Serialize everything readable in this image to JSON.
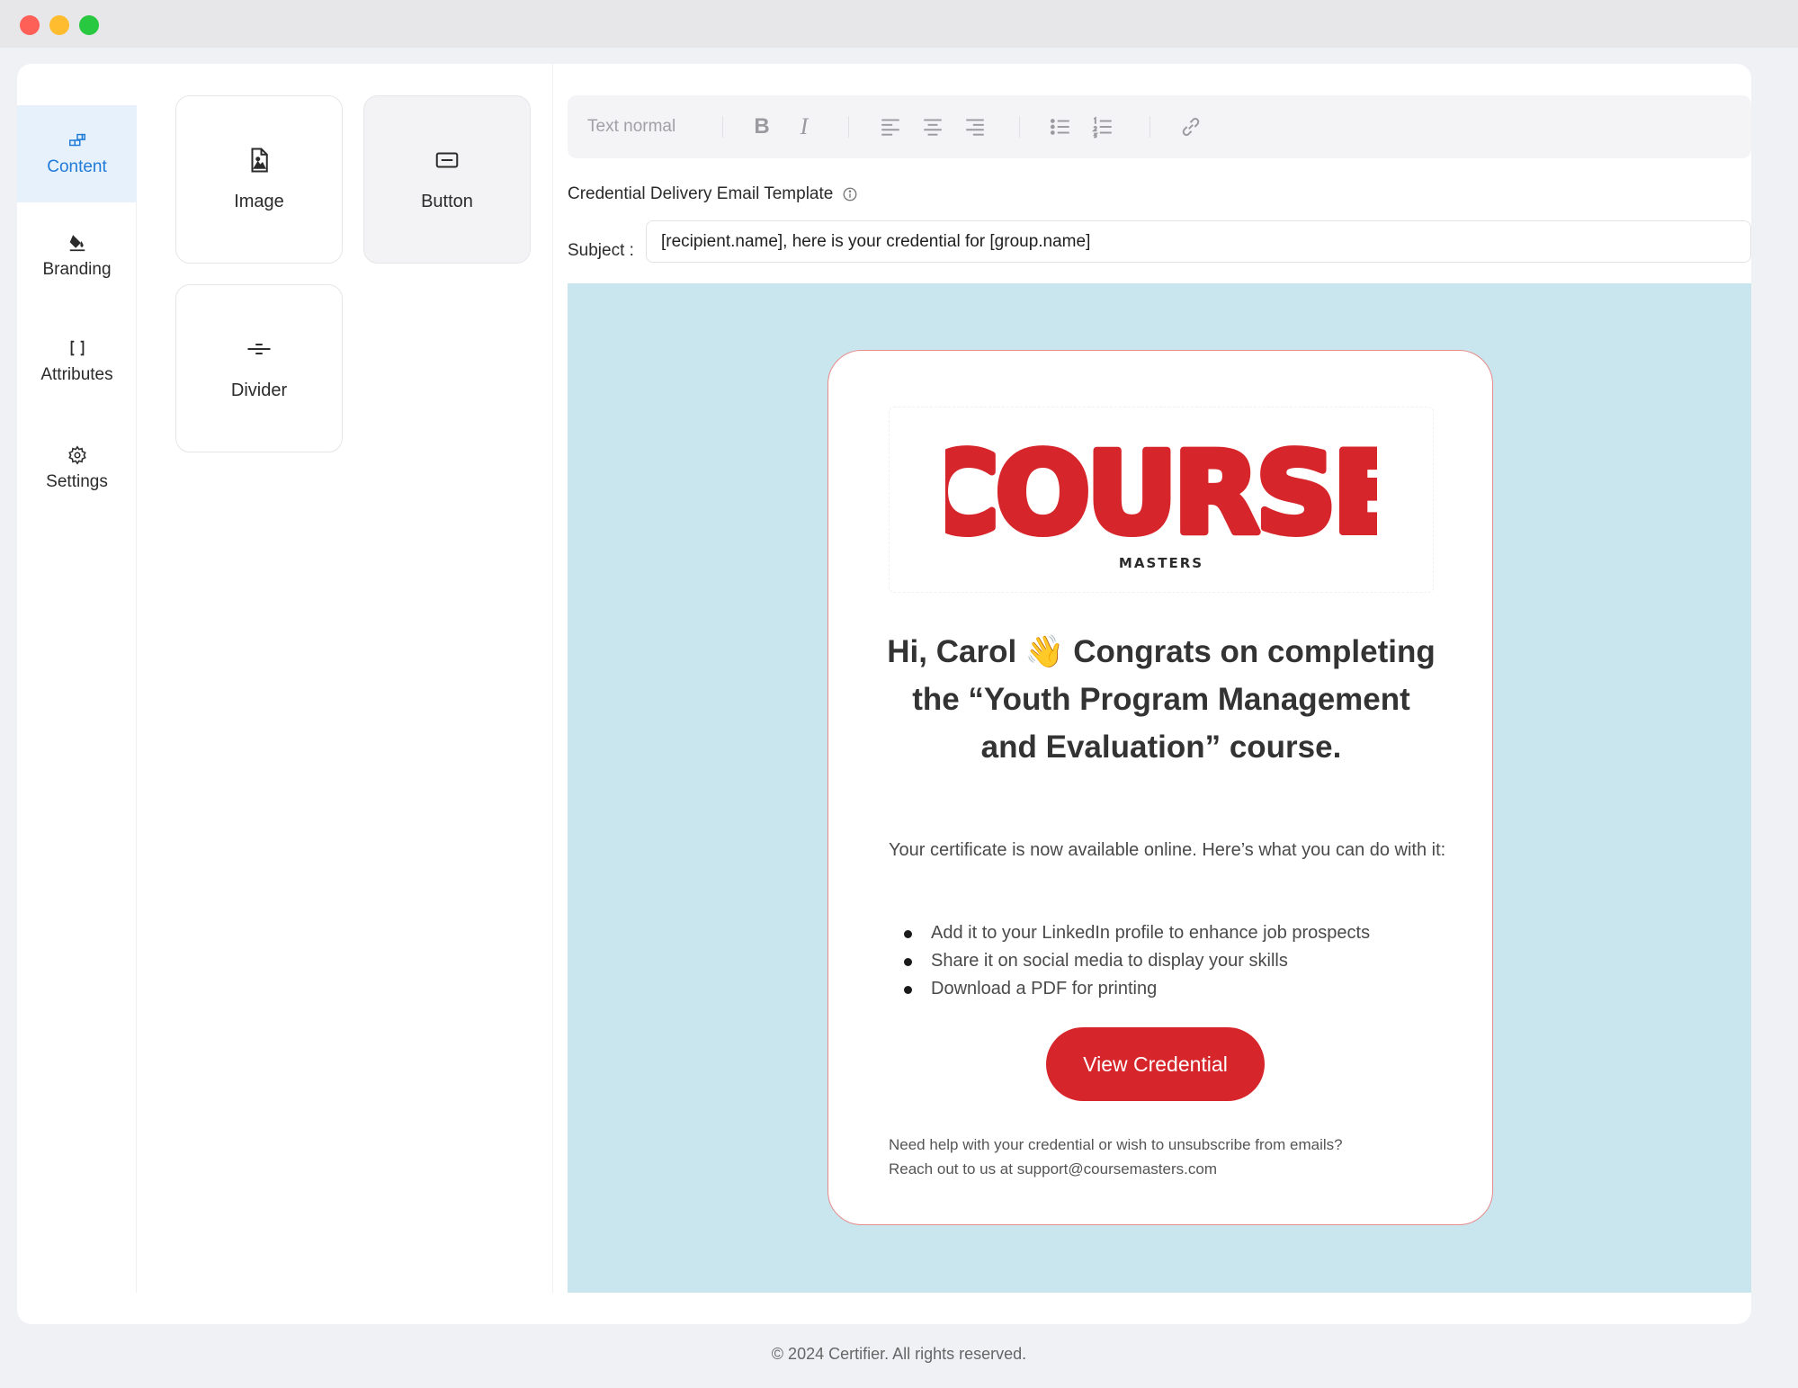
{
  "nav": {
    "items": [
      {
        "label": "Content",
        "icon": "blocks-icon"
      },
      {
        "label": "Branding",
        "icon": "paint-bucket-icon"
      },
      {
        "label": "Attributes",
        "icon": "brackets-icon"
      },
      {
        "label": "Settings",
        "icon": "gear-icon"
      }
    ]
  },
  "palette": {
    "blocks": [
      {
        "label": "Image",
        "icon": "image-icon"
      },
      {
        "label": "Button",
        "icon": "button-icon"
      },
      {
        "label": "Divider",
        "icon": "divider-icon"
      }
    ]
  },
  "toolbar": {
    "text_style": "Text normal"
  },
  "editor": {
    "template_title": "Credential Delivery Email Template",
    "subject_label": "Subject :",
    "subject_value": "[recipient.name], here is your credential for [group.name]"
  },
  "email": {
    "logo_main": "COURSE",
    "logo_sub": "MASTERS",
    "headline": "Hi, Carol 👋 Congrats on completing the “Youth Program Management and Evaluation” course.",
    "intro": "Your certificate is now available online. Here’s what you can do with it:",
    "bullets": [
      "Add it to your LinkedIn profile to enhance job prospects",
      "Share it on social media to display your skills",
      "Download a PDF for printing"
    ],
    "cta_label": "View Credential",
    "footer_line1": "Need help with your credential or wish to unsubscribe from emails?",
    "footer_line2": "Reach out to us at support@coursemasters.com"
  },
  "copyright": "© 2024 Certifier. All rights reserved.",
  "colors": {
    "accent": "#1f7ad8",
    "brand_red": "#d7262b",
    "canvas_bg": "#c9e6ee"
  }
}
